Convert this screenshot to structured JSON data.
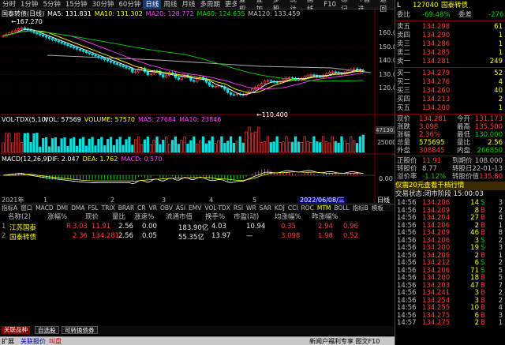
{
  "toolbar": {
    "periods": [
      "分时",
      "1分钟",
      "5分钟",
      "15分钟",
      "30分钟",
      "60分钟",
      "日线",
      "周线",
      "月线",
      "多周期",
      "更多 >"
    ],
    "active_period": "日线",
    "right_buttons": [
      "复权",
      "叠加",
      "多股",
      "统计",
      "画线",
      "F10",
      "标记",
      "+自选",
      "返回"
    ]
  },
  "chart": {
    "title": "国泰转债(日线)",
    "ma_labels": [
      {
        "text": "MA5: 131.831",
        "color": "#ffffff"
      },
      {
        "text": "MA10: 131.302",
        "color": "#ffff00"
      },
      {
        "text": "MA20: 128.772",
        "color": "#ff40ff"
      },
      {
        "text": "MA60: 124.635",
        "color": "#00e000"
      },
      {
        "text": "MA120: 133.459",
        "color": "#c0c0c0"
      }
    ],
    "high_label": "167.270",
    "low_label": "110.400",
    "y_ticks": [
      "160.0",
      "150.0",
      "140.0",
      "130.0",
      "120.0"
    ],
    "vol_title": "VOL-TDX(5,10)",
    "vol_labels": [
      {
        "text": "VOL: 57569",
        "color": "#ffffff"
      },
      {
        "text": "VOLUME: 57570",
        "color": "#ffff00"
      },
      {
        "text": "MA5: 27684",
        "color": "#ff40ff"
      },
      {
        "text": "MA10: 23846",
        "color": "#ff40ff"
      }
    ],
    "vol_ticks": [
      "47130.52",
      "25000"
    ],
    "macd_title": "MACD(12,26,9)",
    "macd_labels": [
      {
        "text": "DIF: 2.047",
        "color": "#ffffff"
      },
      {
        "text": "DEA: 1.762",
        "color": "#ffff00"
      },
      {
        "text": "MACD: 0.570",
        "color": "#ff40ff"
      }
    ],
    "macd_ticks": [
      "0.00"
    ],
    "date_axis": [
      "2021年",
      "1",
      "2",
      "3",
      "4",
      "5",
      "2022/06/08/三"
    ],
    "period_right": "日线"
  },
  "indicator_tabs": [
    "指标A",
    "窗口",
    "MACD",
    "DMI",
    "DMA",
    "FSL",
    "TRIX",
    "BRAR",
    "CR",
    "VR",
    "OBV",
    "ASI",
    "EMV",
    "VOL-TDX",
    "RSI",
    "WR",
    "SAR",
    "KDJ",
    "CCI",
    "ROC",
    "MTM",
    "BOLL",
    "指标B",
    "模板"
  ],
  "table": {
    "headers": [
      "名称(2)",
      "涨幅%",
      "现价",
      "量比",
      "涨速%",
      "流通市值",
      "换手%",
      "市盈(动)",
      "均涨幅%",
      "昨涨幅%"
    ],
    "rows": [
      {
        "idx": "1",
        "name": "江苏国泰",
        "mark": "R",
        "chg": "3.03",
        "price": "11.91",
        "ratio": "2.56",
        "speed": "0.00",
        "mcap": "183.90亿",
        "turnover": "4.03",
        "pe": "10.94",
        "avgchg": "0.35",
        "prev": "2.94",
        "last": "0.96"
      },
      {
        "idx": "2",
        "name": "国泰转债",
        "mark": "",
        "chg": "2.36",
        "price": "134.281",
        "ratio": "2.56",
        "speed": "0.05",
        "mcap": "55.35亿",
        "turnover": "13.97",
        "pe": "—",
        "avgchg": "3.098",
        "prev": "1.98",
        "last": "0.52"
      }
    ]
  },
  "bottom": {
    "tags": [
      "关联品种",
      "自选股",
      "可转换债券"
    ],
    "status": [
      "扩展",
      "关联报价",
      "叫盘"
    ],
    "ticker_news": "新闻户福利专享 图文F10"
  },
  "right_panel": {
    "code": "127040",
    "name": "国泰转债",
    "ratio_label": "委比",
    "ratio_value": "-69.48%",
    "diff_label": "委差",
    "diff_value": "-276",
    "asks": [
      {
        "lvl": "卖五",
        "price": "134.298",
        "vol": "61"
      },
      {
        "lvl": "卖四",
        "price": "134.290",
        "vol": "1"
      },
      {
        "lvl": "卖三",
        "price": "134.286",
        "vol": "1"
      },
      {
        "lvl": "卖二",
        "price": "134.285",
        "vol": "1"
      },
      {
        "lvl": "卖一",
        "price": "134.281",
        "vol": "249"
      }
    ],
    "bids": [
      {
        "lvl": "买一",
        "price": "134.279",
        "vol": "52"
      },
      {
        "lvl": "买二",
        "price": "134.276",
        "vol": "4"
      },
      {
        "lvl": "买三",
        "price": "134.260",
        "vol": "40"
      },
      {
        "lvl": "买四",
        "price": "134.213",
        "vol": "2"
      },
      {
        "lvl": "买五",
        "price": "134.200",
        "vol": "1"
      }
    ],
    "stats": [
      {
        "k1": "现价",
        "v1": "134.281",
        "k2": "今开",
        "v2": "131.173"
      },
      {
        "k1": "涨跌",
        "v1": "3.098",
        "k2": "最高",
        "v2": "135.500"
      },
      {
        "k1": "涨幅",
        "v1": "2.36%",
        "k2": "最低",
        "v2": "130.000"
      },
      {
        "k1": "总量",
        "v1": "575695",
        "k2": "量比",
        "v2": "2.56"
      },
      {
        "k1": "外盘",
        "v1": "308845",
        "k2": "内盘",
        "v2": "266850"
      }
    ],
    "convert": [
      {
        "k1": "正股价",
        "v1": "11.91",
        "k2": "到期价",
        "v2": "108.000"
      },
      {
        "k1": "转股价",
        "v1": "8.77",
        "k2": "转股日",
        "v2": "22-01-13"
      },
      {
        "k1": "溢价率",
        "v1": "-1.12%",
        "k2": "转股价值",
        "v2": "135.80"
      }
    ],
    "promo": "仅需20元查看千档行情",
    "status_line": "交易状态:闭市阶段 15:00:03",
    "ticks": [
      {
        "t": "14:56",
        "p": "134.206",
        "v": "14",
        "n": "S",
        "c": "3"
      },
      {
        "t": "14:56",
        "p": "134.209",
        "v": "8",
        "n": "B",
        "c": "2"
      },
      {
        "t": "14:56",
        "p": "134.204",
        "v": "27",
        "n": "B",
        "c": "4"
      },
      {
        "t": "14:56",
        "p": "134.206",
        "v": "2",
        "n": "B",
        "c": "1"
      },
      {
        "t": "14:56",
        "p": "134.209",
        "v": "46",
        "n": "B",
        "c": "8"
      },
      {
        "t": "14:56",
        "p": "134.206",
        "v": "3",
        "n": "S",
        "c": "2"
      },
      {
        "t": "14:56",
        "p": "134.200",
        "v": "19",
        "n": "S",
        "c": "3"
      },
      {
        "t": "14:56",
        "p": "134.206",
        "v": "2",
        "n": "B",
        "c": "1"
      },
      {
        "t": "14:56",
        "p": "134.212",
        "v": "6",
        "n": "S",
        "c": "2"
      },
      {
        "t": "14:56",
        "p": "134.206",
        "v": "71",
        "n": "S",
        "c": "5"
      },
      {
        "t": "14:56",
        "p": "134.200",
        "v": "18",
        "n": "B",
        "c": "5"
      },
      {
        "t": "14:56",
        "p": "134.203",
        "v": "47",
        "n": "B",
        "c": "7"
      },
      {
        "t": "14:56",
        "p": "134.241",
        "v": "3",
        "n": "B",
        "c": "2"
      },
      {
        "t": "14:56",
        "p": "134.254",
        "v": "3",
        "n": "B",
        "c": "2"
      },
      {
        "t": "14:56",
        "p": "134.255",
        "v": "10",
        "n": "B",
        "c": "4"
      },
      {
        "t": "14:56",
        "p": "134.275",
        "v": "6",
        "n": "B",
        "c": "3"
      },
      {
        "t": "14:57",
        "p": "134.275",
        "v": "2",
        "n": "B",
        "c": "1"
      },
      {
        "t": "15:00",
        "p": "134.281",
        "v": "2660",
        "n": "",
        "c": "17"
      }
    ]
  },
  "colors": {
    "up": "#ff3c3c",
    "down": "#00d000",
    "bg": "#000000",
    "accent": "#ffff00"
  }
}
